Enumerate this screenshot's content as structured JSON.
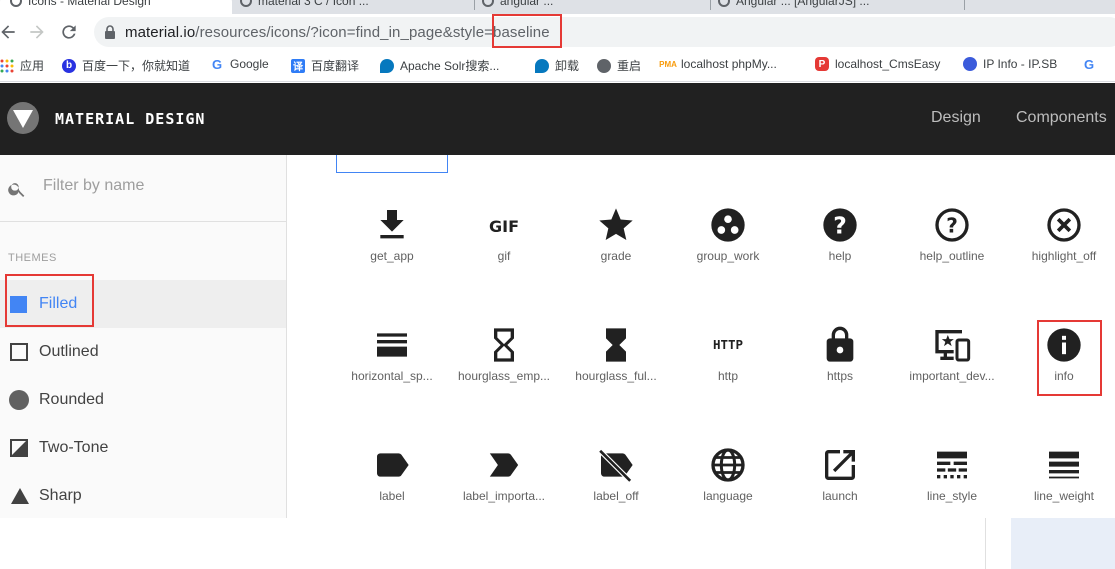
{
  "browser": {
    "tabs": [
      {
        "title": "Icons - Material Design",
        "active": true
      },
      {
        "title": "material 3 C / Icon ... "
      },
      {
        "title": "angular ..."
      },
      {
        "title": "Angular ... [AngularJS] ..."
      }
    ],
    "url_host": "material.io",
    "url_path": "/resources/icons/?icon=find_in_page&style=",
    "url_highlight": "baseline",
    "bookmarks": [
      {
        "label": "应用",
        "icon": "apps-grid-icon"
      },
      {
        "label": "百度一下，你就知道",
        "icon": "baidu-icon"
      },
      {
        "label": "Google",
        "icon": "google-icon"
      },
      {
        "label": "百度翻译",
        "icon": "translate-icon"
      },
      {
        "label": "Apache Solr搜索...",
        "icon": "drupal-icon"
      },
      {
        "label": "卸载",
        "icon": "drupal-icon"
      },
      {
        "label": "重启",
        "icon": "globe-icon"
      },
      {
        "label": "localhost phpMy...",
        "icon": "phpmyadmin-icon"
      },
      {
        "label": "localhost_CmsEasy",
        "icon": "p-icon"
      },
      {
        "label": "IP Info - IP.SB",
        "icon": "db-icon"
      },
      {
        "label": "G",
        "icon": "google-icon"
      }
    ]
  },
  "header": {
    "title": "MATERIAL DESIGN",
    "nav": [
      "Design",
      "Components"
    ]
  },
  "sidebar": {
    "filter_placeholder": "Filter by name",
    "themes_label": "THEMES",
    "themes": [
      {
        "label": "Filled",
        "active": true
      },
      {
        "label": "Outlined"
      },
      {
        "label": "Rounded"
      },
      {
        "label": "Two-Tone"
      },
      {
        "label": "Sharp"
      }
    ]
  },
  "icons": [
    [
      "get_app",
      "gif",
      "grade",
      "group_work",
      "help",
      "help_outline",
      "highlight_off"
    ],
    [
      "horizontal_sp...",
      "hourglass_emp...",
      "hourglass_ful...",
      "http",
      "https",
      "important_dev...",
      "info"
    ],
    [
      "label",
      "label_importa...",
      "label_off",
      "language",
      "launch",
      "line_style",
      "line_weight"
    ]
  ],
  "colors": {
    "accent": "#4285f4",
    "highlight": "#e53935",
    "header": "#212121",
    "icon": "#212121"
  }
}
